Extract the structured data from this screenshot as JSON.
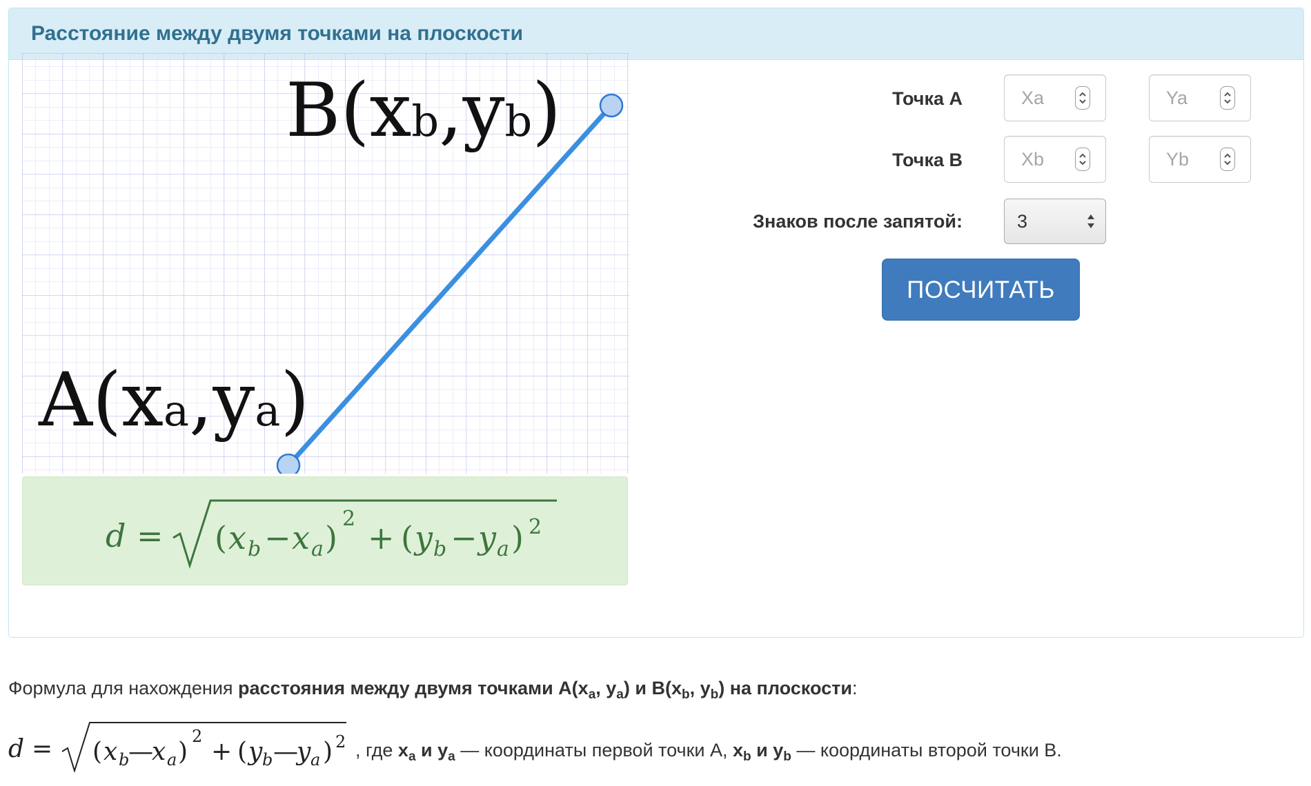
{
  "panel": {
    "title": "Расстояние между двумя точками на плоскости"
  },
  "illustration": {
    "label_b": {
      "main": "B(x",
      "sub1": "b",
      "mid": ",y",
      "sub2": "b",
      "close": ")"
    },
    "label_a": {
      "main": "A(x",
      "sub1": "a",
      "mid": ",y",
      "sub2": "a",
      "close": ")"
    },
    "line_color": "#3b8fe0",
    "grid_color": "#b8bde8"
  },
  "formula_box": {
    "formula_text": "d = √((x_b − x_a)² + (y_b − y_a)²)"
  },
  "form": {
    "point_a_label": "Точка A",
    "point_b_label": "Точка B",
    "decimals_label": "Знаков после запятой:",
    "xa_placeholder": "Xa",
    "ya_placeholder": "Ya",
    "xb_placeholder": "Xb",
    "yb_placeholder": "Yb",
    "decimals_value": "3",
    "calculate_label": "ПОСЧИТАТЬ"
  },
  "description": {
    "intro_start": "Формула для нахождения ",
    "intro_bold_1": "расстояния между двумя точками A(x",
    "intro_sub_1": "a",
    "intro_bold_2": ", y",
    "intro_sub_2": "a",
    "intro_bold_3": ") и B(x",
    "intro_sub_3": "b",
    "intro_bold_4": ", y",
    "intro_sub_4": "b",
    "intro_bold_5": ") на плоскости",
    "intro_end": ":",
    "tail_1": ", где ",
    "tail_xa": "x",
    "tail_xa_sub": "a",
    "tail_and_1": " и ",
    "tail_ya": "y",
    "tail_ya_sub": "a",
    "tail_2": " — координаты первой точки A, ",
    "tail_xb": "x",
    "tail_xb_sub": "b",
    "tail_and_2": " и ",
    "tail_yb": "y",
    "tail_yb_sub": "b",
    "tail_3": " — координаты второй точки B."
  },
  "colors": {
    "panel_heading_bg": "#d9edf7",
    "panel_title": "#31708f",
    "formula_bg": "#dff0d8",
    "formula_text": "#3c763d",
    "button_bg": "#3f7bbd"
  }
}
